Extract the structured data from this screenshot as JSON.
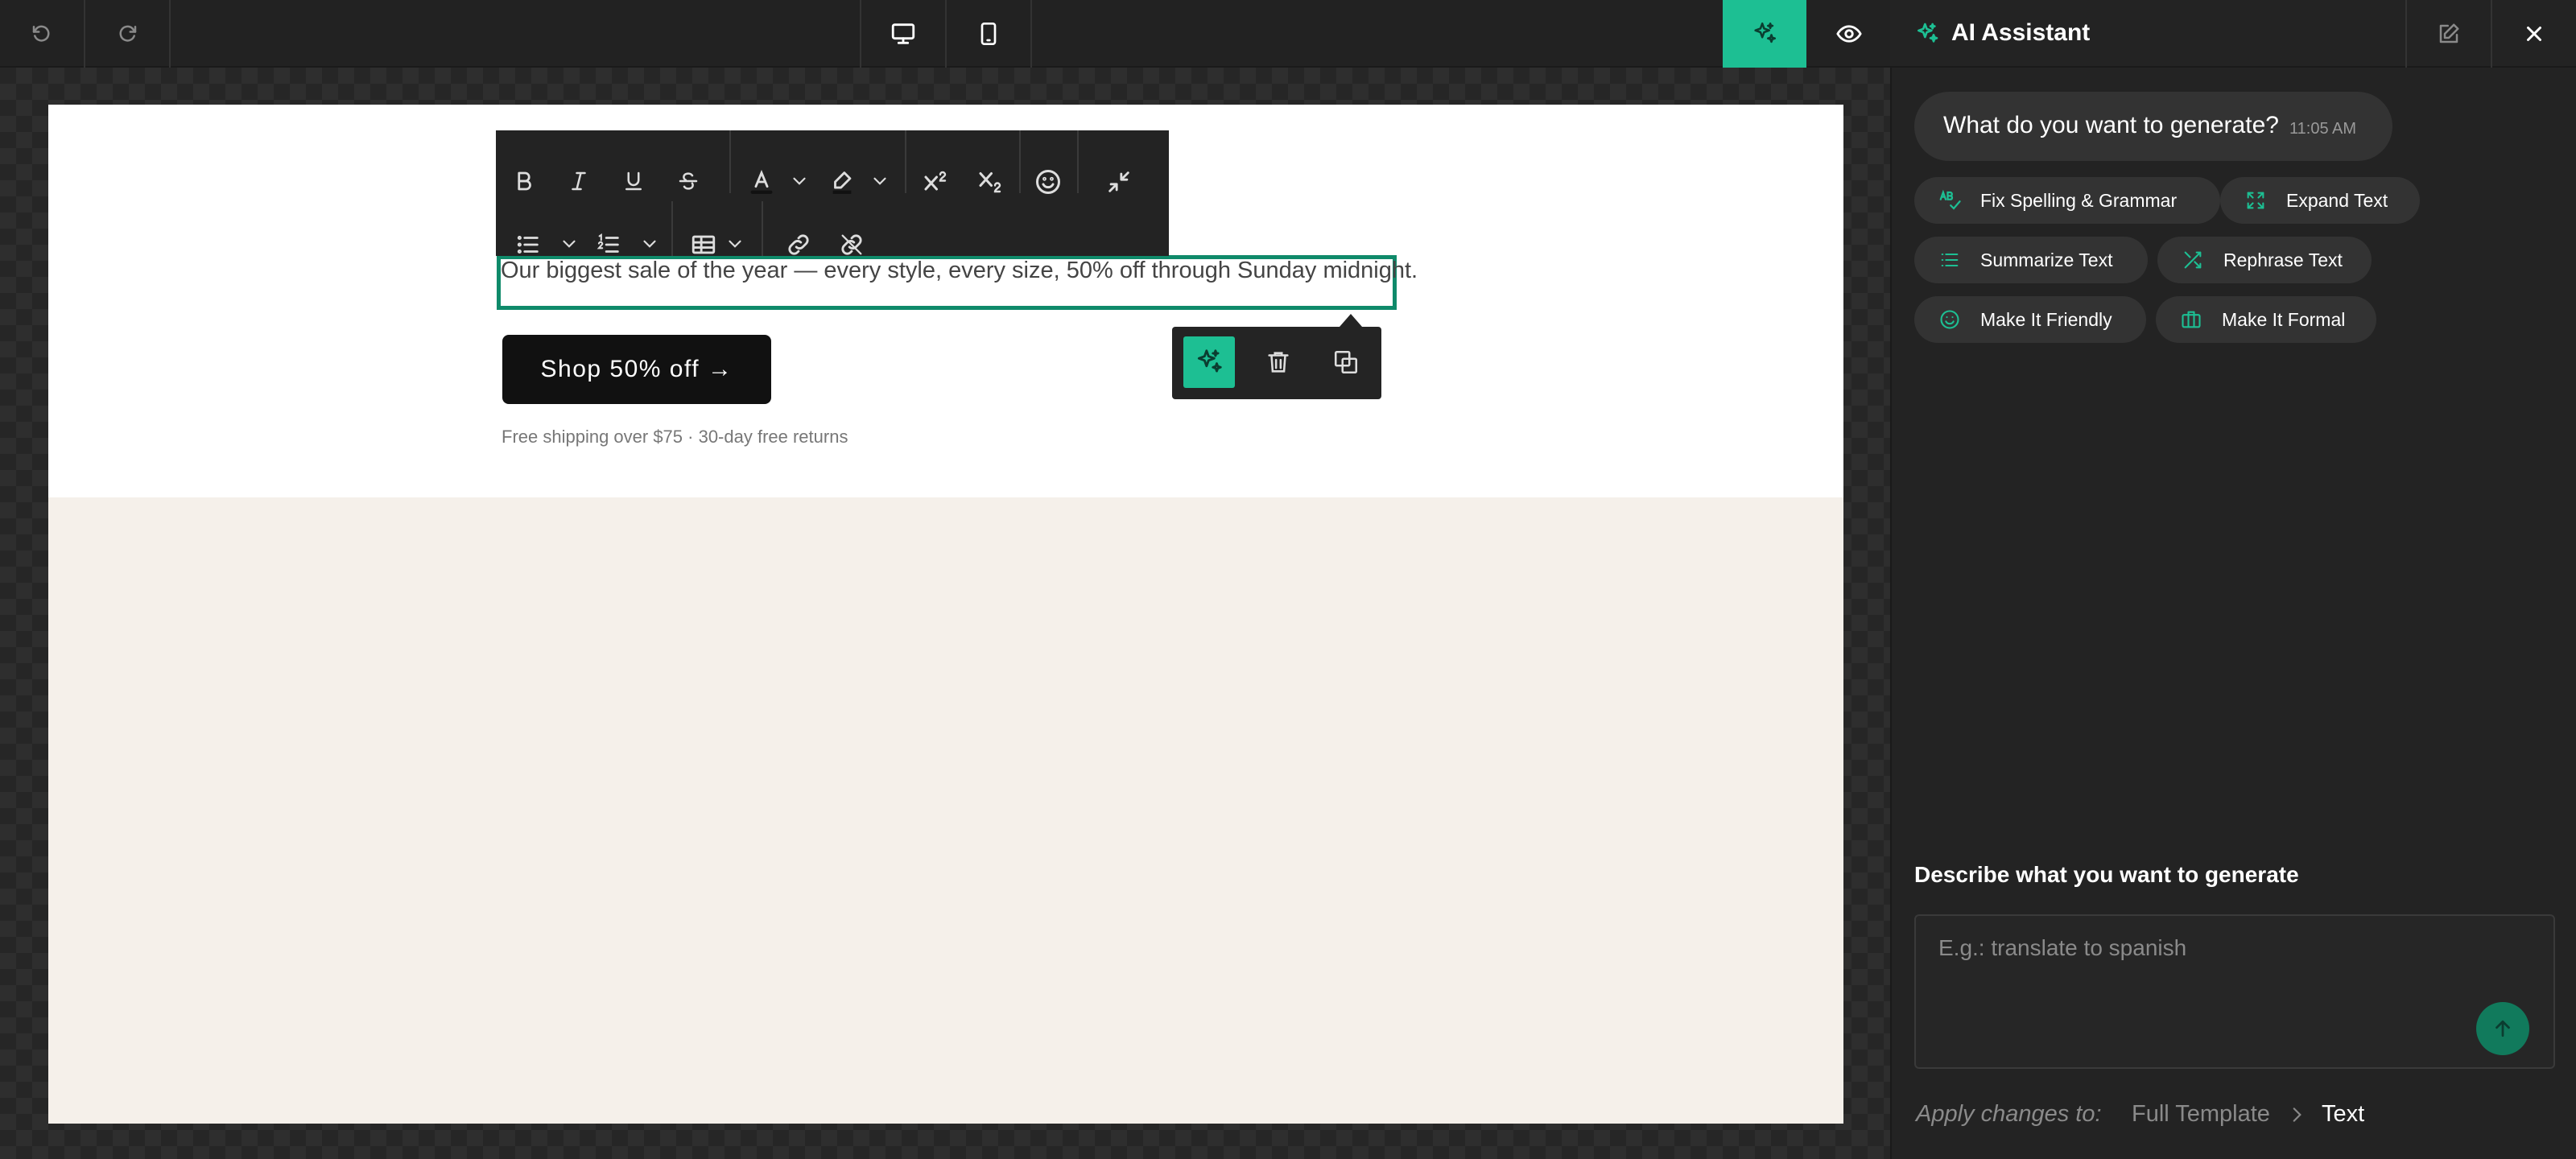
{
  "toolbar": {
    "undo_icon": "undo-icon",
    "redo_icon": "redo-icon",
    "desktop_icon": "desktop-icon",
    "mobile_icon": "mobile-icon",
    "ai_icon": "sparkle-icon",
    "preview_icon": "eye-icon"
  },
  "colors": {
    "accent": "#1dbf93",
    "accent_dark": "#117a5c",
    "selection_border": "#0f8a6a",
    "panel_bg": "#232323",
    "chip_bg": "#333333",
    "email_cream": "#f5f0ea"
  },
  "rich_text_toolbar": {
    "row1": [
      "bold-icon",
      "italic-icon",
      "underline-icon",
      "strikethrough-icon",
      "font-color-icon",
      "highlight-icon",
      "superscript-icon",
      "subscript-icon",
      "emoji-icon",
      "collapse-icon"
    ],
    "row2": [
      "bullet-list-icon",
      "numbered-list-icon",
      "table-icon",
      "link-icon",
      "unlink-icon"
    ]
  },
  "email": {
    "body_text": "Our biggest sale of the year — every style, every size, 50% off through Sunday midnight.",
    "button_label": "Shop 50% off →",
    "fine_print": "Free shipping over $75 · 30-day free returns"
  },
  "block_menu": {
    "items": [
      "sparkle-icon",
      "trash-icon",
      "duplicate-icon"
    ]
  },
  "panel": {
    "title": "AI Assistant",
    "prompt_question": "What do you want to generate?",
    "prompt_time": "11:05 AM",
    "chips": [
      {
        "label": "Fix Spelling & Grammar",
        "icon": "spellcheck-icon"
      },
      {
        "label": "Expand Text",
        "icon": "expand-icon"
      },
      {
        "label": "Summarize Text",
        "icon": "list-icon"
      },
      {
        "label": "Rephrase Text",
        "icon": "shuffle-icon"
      },
      {
        "label": "Make It Friendly",
        "icon": "smile-icon"
      },
      {
        "label": "Make It Formal",
        "icon": "briefcase-icon"
      }
    ],
    "describe_label": "Describe what you want to generate",
    "input_placeholder": "E.g.: translate to spanish",
    "apply_label": "Apply changes to:",
    "apply_options": [
      "Full Template",
      "Text"
    ],
    "apply_selected": "Text"
  }
}
